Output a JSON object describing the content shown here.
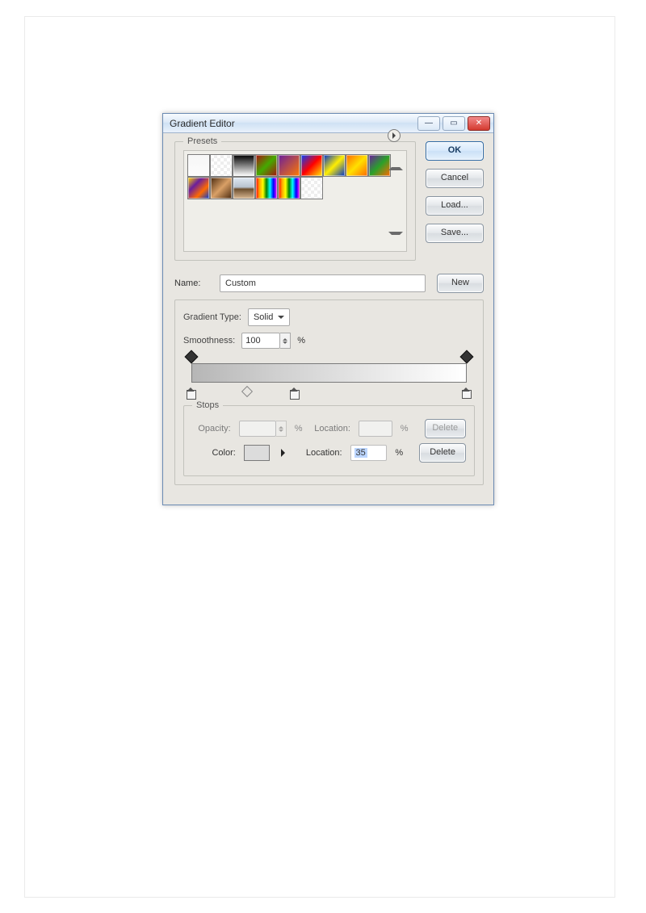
{
  "window": {
    "title": "Gradient Editor"
  },
  "buttons": {
    "ok": "OK",
    "cancel": "Cancel",
    "load": "Load...",
    "save": "Save...",
    "new": "New",
    "delete_opacity": "Delete",
    "delete_color": "Delete"
  },
  "groups": {
    "presets": "Presets",
    "stops": "Stops"
  },
  "name": {
    "label": "Name:",
    "value": "Custom"
  },
  "gradient": {
    "type_label": "Gradient Type:",
    "type_value": "Solid",
    "smoothness_label": "Smoothness:",
    "smoothness_value": "100",
    "percent": "%"
  },
  "stops": {
    "opacity_label": "Opacity:",
    "opacity_value": "",
    "opacity_location_label": "Location:",
    "opacity_location_value": "",
    "color_label": "Color:",
    "color_location_label": "Location:",
    "color_location_value": "35",
    "pct": "%"
  },
  "presets": [
    {
      "name": "foreground-to-background",
      "css": "linear-gradient(#f6f6f6,#fcfcfc)"
    },
    {
      "name": "foreground-to-transparent",
      "css": "repeating-conic-gradient(#eee 0 25%,#fff 0 50%) 0 0/8px 8px"
    },
    {
      "name": "black-white",
      "css": "linear-gradient(#000,#fff)"
    },
    {
      "name": "red-green",
      "css": "linear-gradient(135deg,#a11,#4a0,#a11)"
    },
    {
      "name": "violet-orange",
      "css": "linear-gradient(135deg,#6a1e9c,#ff7a00)"
    },
    {
      "name": "blue-red-yellow",
      "css": "linear-gradient(135deg,#0040ff,#ff0000,#ffee00)"
    },
    {
      "name": "blue-yellow-blue",
      "css": "linear-gradient(135deg,#0033cc,#ffee00,#0033cc)"
    },
    {
      "name": "orange-yellow-orange",
      "css": "linear-gradient(135deg,#ff6a00,#ffe000,#ff6a00)"
    },
    {
      "name": "violet-green-orange",
      "css": "linear-gradient(135deg,#6a1e9c,#2aa12a,#ff6a00)"
    },
    {
      "name": "yellow-violet-orange-blue",
      "css": "linear-gradient(135deg,#ffd800,#6a1e9c,#ff6a00,#003bd6)"
    },
    {
      "name": "copper",
      "css": "linear-gradient(135deg,#4a2a10,#d9a066,#4a2a10)"
    },
    {
      "name": "chrome",
      "css": "linear-gradient(#dfe8f2 0%,#b8c3cf 45%,#6d4f2f 55%,#d8b792 100%)"
    },
    {
      "name": "spectrum",
      "css": "linear-gradient(90deg,red,orange,yellow,green,cyan,blue,magenta)"
    },
    {
      "name": "transparent-rainbow",
      "css": "linear-gradient(90deg,red,orange,yellow,green,cyan,blue,magenta)"
    },
    {
      "name": "transparent-stripes",
      "css": "repeating-conic-gradient(#eee 0 25%,#fff 0 50%) 0 0/8px 8px"
    }
  ]
}
